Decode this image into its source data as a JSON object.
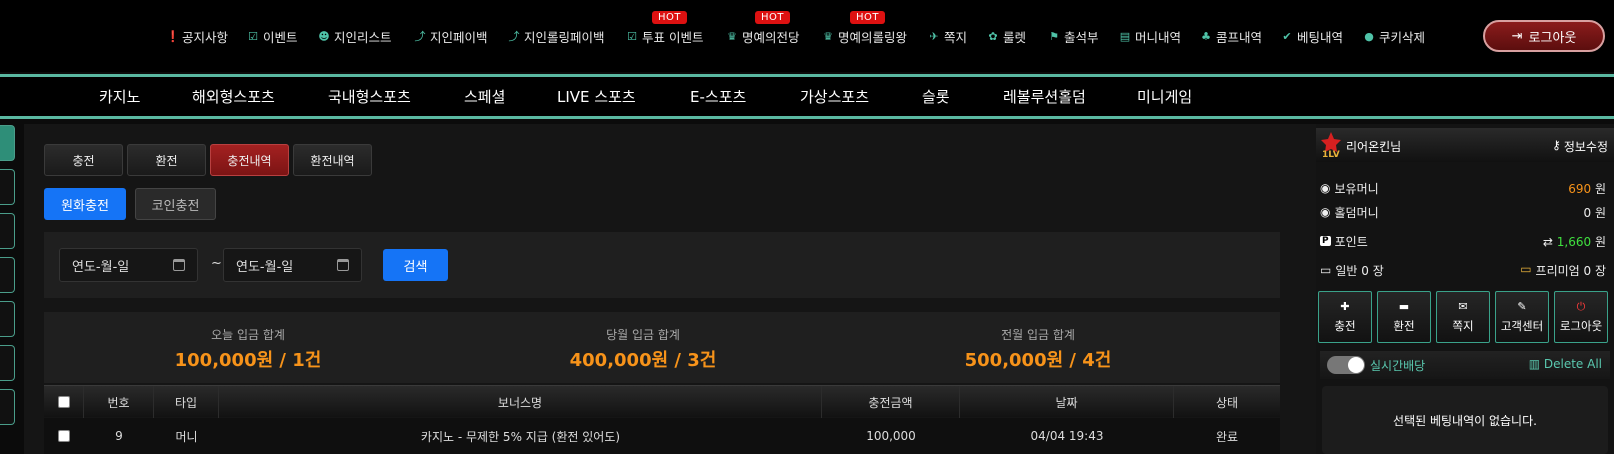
{
  "topnav": {
    "items": [
      {
        "label": "공지사항",
        "icon": "alert-circle-icon",
        "glyph": "❗"
      },
      {
        "label": "이벤트",
        "icon": "calendar-check-icon",
        "glyph": "☑"
      },
      {
        "label": "지인리스트",
        "icon": "users-icon",
        "glyph": "👥"
      },
      {
        "label": "지인페이백",
        "icon": "hand-coin-icon",
        "glyph": "⤴"
      },
      {
        "label": "지인롤링페이백",
        "icon": "hand-coin-icon",
        "glyph": "⤴"
      },
      {
        "label": "투표 이벤트",
        "icon": "vote-box-icon",
        "glyph": "☑"
      },
      {
        "label": "명예의전당",
        "icon": "trophy-icon",
        "glyph": "🏆"
      },
      {
        "label": "명예의롤링왕",
        "icon": "trophy-icon",
        "glyph": "🏆"
      },
      {
        "label": "쪽지",
        "icon": "paper-plane-icon",
        "glyph": "✈"
      },
      {
        "label": "룰렛",
        "icon": "gift-icon",
        "glyph": "🎁"
      },
      {
        "label": "출석부",
        "icon": "stamp-icon",
        "glyph": "⚑"
      },
      {
        "label": "머니내역",
        "icon": "clipboard-icon",
        "glyph": "📋"
      },
      {
        "label": "콤프내역",
        "icon": "piggy-bank-icon",
        "glyph": "🐖"
      },
      {
        "label": "베팅내역",
        "icon": "check-icon",
        "glyph": "✔"
      },
      {
        "label": "쿠키삭제",
        "icon": "cookie-icon",
        "glyph": "●"
      }
    ],
    "hot_badge": "HOT",
    "logout": {
      "label": "로그아웃",
      "icon": "sign-out-icon",
      "glyph": "⇥"
    }
  },
  "mainnav": {
    "items": [
      "카지노",
      "해외형스포츠",
      "국내형스포츠",
      "스페셜",
      "LIVE 스포츠",
      "E-스포츠",
      "가상스포츠",
      "슬롯",
      "레볼루션홀덤",
      "미니게임"
    ]
  },
  "tabs": [
    "충전",
    "환전",
    "충전내역",
    "환전내역"
  ],
  "active_tab": "충전내역",
  "subtabs": [
    "원화충전",
    "코인충전"
  ],
  "active_subtab": "원화충전",
  "search": {
    "date_from_placeholder": "연도-월-일",
    "date_to_placeholder": "연도-월-일",
    "separator": "~",
    "button": "검색"
  },
  "summary": [
    {
      "label": "오늘 입금 합계",
      "value": "100,000원 / 1건"
    },
    {
      "label": "당월 입금 합계",
      "value": "400,000원 / 3건"
    },
    {
      "label": "전월 입금 합계",
      "value": "500,000원 / 4건"
    }
  ],
  "table": {
    "headers": {
      "no": "번호",
      "type": "타입",
      "bonus": "보너스명",
      "amount": "충전금액",
      "date": "날짜",
      "status": "상태"
    },
    "rows": [
      {
        "no": "9",
        "type": "머니",
        "bonus": "카지노 - 무제한 5% 지급 (환전 있어도)",
        "amount": "100,000",
        "date": "04/04 19:43",
        "status": "완료"
      }
    ]
  },
  "sidebar": {
    "username": "리어온킨님",
    "info_edit": "정보수정",
    "balances": [
      {
        "label": "보유머니",
        "value": "690",
        "unit": "원",
        "color": "#f7931a"
      },
      {
        "label": "홀덤머니",
        "value": "0",
        "unit": "원",
        "color": "#ffffff"
      },
      {
        "label": "포인트",
        "value": "1,660",
        "unit": "원",
        "color": "#3fe03f"
      }
    ],
    "tickets": {
      "general": "일반 0 장",
      "premium": "프리미엄 0 장"
    },
    "buttons": [
      {
        "label": "충전",
        "icon": "plus-square-icon",
        "glyph": "➕"
      },
      {
        "label": "환전",
        "icon": "minus-square-icon",
        "glyph": "➖"
      },
      {
        "label": "쪽지",
        "icon": "envelope-icon",
        "glyph": "✉"
      },
      {
        "label": "고객센터",
        "icon": "edit-icon",
        "glyph": "✎"
      },
      {
        "label": "로그아웃",
        "icon": "power-icon",
        "glyph": "⏻"
      }
    ],
    "live_label": "실시간배당",
    "delete_all": "Delete All",
    "empty_bets": "선택된 베팅내역이 없습니다."
  },
  "colors": {
    "accent": "#5ab8a1",
    "active_tab": "#a42121",
    "primary": "#1574f6",
    "amount": "#f7931a",
    "hot": "#dd1111"
  }
}
